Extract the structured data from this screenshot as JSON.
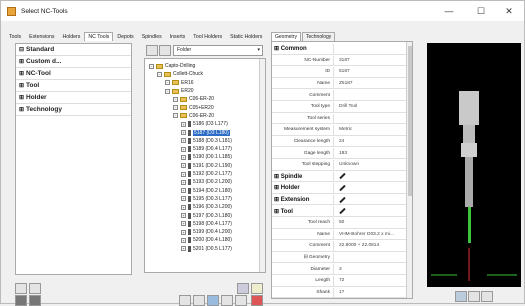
{
  "window": {
    "title": "Select NC-Tools",
    "minimize": "—",
    "maximize": "☐",
    "close": "✕"
  },
  "tabs": [
    "Tools",
    "Extensions",
    "Holders",
    "NC Tools",
    "Depots",
    "Spindles",
    "Inserts",
    "Tool Holders",
    "Static Holders"
  ],
  "active_tab": "NC Tools",
  "categories": [
    "Standard",
    "Custom d...",
    "NC-Tool",
    "Tool",
    "Holder",
    "Technology"
  ],
  "tree": {
    "filter_label": "Folder",
    "nodes": [
      {
        "label": "Capto-Drilling",
        "kind": "folder",
        "level": 0
      },
      {
        "label": "Collett-Chuck",
        "kind": "folder",
        "level": 1
      },
      {
        "label": "ER16",
        "kind": "folder",
        "level": 2
      },
      {
        "label": "ER20",
        "kind": "folder",
        "level": 2
      },
      {
        "label": "C06-ER-20",
        "kind": "folder",
        "level": 3
      },
      {
        "label": "C05+ER20",
        "kind": "folder",
        "level": 3
      },
      {
        "label": "C06-ER-20",
        "kind": "folder",
        "level": 3
      },
      {
        "label": "5186  (D3 L177)",
        "kind": "tool",
        "level": 4
      },
      {
        "label": "5187  (D3 L180)",
        "kind": "tool",
        "level": 4,
        "selected": true
      },
      {
        "label": "5188  (D0.3 L181)",
        "kind": "tool",
        "level": 4
      },
      {
        "label": "5189  (D0.4 L177)",
        "kind": "tool",
        "level": 4
      },
      {
        "label": "5190  (D0.1 L185)",
        "kind": "tool",
        "level": 4
      },
      {
        "label": "5191  (D0.2 L190)",
        "kind": "tool",
        "level": 4
      },
      {
        "label": "5192  (D0.2 L177)",
        "kind": "tool",
        "level": 4
      },
      {
        "label": "5193  (D0.2 L200)",
        "kind": "tool",
        "level": 4
      },
      {
        "label": "5194  (D0.2 L180)",
        "kind": "tool",
        "level": 4
      },
      {
        "label": "5195  (D0.3 L177)",
        "kind": "tool",
        "level": 4
      },
      {
        "label": "5196  (D0.3 L200)",
        "kind": "tool",
        "level": 4
      },
      {
        "label": "5197  (D0.3 L180)",
        "kind": "tool",
        "level": 4
      },
      {
        "label": "5198  (D0.4 L177)",
        "kind": "tool",
        "level": 4
      },
      {
        "label": "5199  (D0.4 L200)",
        "kind": "tool",
        "level": 4
      },
      {
        "label": "5200  (D0.4 L180)",
        "kind": "tool",
        "level": 4
      },
      {
        "label": "5201  (D0.5 L177)",
        "kind": "tool",
        "level": 4
      }
    ]
  },
  "props_tabs": [
    "Geometry",
    "Technology"
  ],
  "properties": [
    {
      "key": "Common",
      "value": "",
      "group": true
    },
    {
      "key": "NC-Number",
      "value": "3187"
    },
    {
      "key": "ID",
      "value": "5187"
    },
    {
      "key": "Name",
      "value": "Z5187"
    },
    {
      "key": "Comment",
      "value": ""
    },
    {
      "key": "Tool type",
      "value": "Drill Tool"
    },
    {
      "key": "Tool series",
      "value": ""
    },
    {
      "key": "Measurement system",
      "value": "Metric"
    },
    {
      "key": "Clearance length",
      "value": "24"
    },
    {
      "key": "Gage length",
      "value": "183"
    },
    {
      "key": "Tool stepping",
      "value": "Unknown"
    },
    {
      "key": "Spindle",
      "value": "",
      "group": true,
      "editable": true
    },
    {
      "key": "Holder",
      "value": "",
      "group": true,
      "editable": true
    },
    {
      "key": "Extension",
      "value": "",
      "group": true,
      "editable": true
    },
    {
      "key": "Tool",
      "value": "",
      "group": true,
      "editable": true
    },
    {
      "key": "Tool reach",
      "value": "50"
    },
    {
      "key": "Name",
      "value": "VHM-Bohrer D03.2 x mi..."
    },
    {
      "key": "Comment",
      "value": "22.8000 + 22.0814"
    },
    {
      "key": "Geometry",
      "value": "",
      "subgroup": true
    },
    {
      "key": "Diameter",
      "value": "3"
    },
    {
      "key": "Length",
      "value": "72"
    },
    {
      "key": "Shank",
      "value": "1?"
    }
  ],
  "colors": {
    "selection": "#2c6cc4",
    "preview_bg": "#000000",
    "tool_green": "#3ac43a"
  }
}
